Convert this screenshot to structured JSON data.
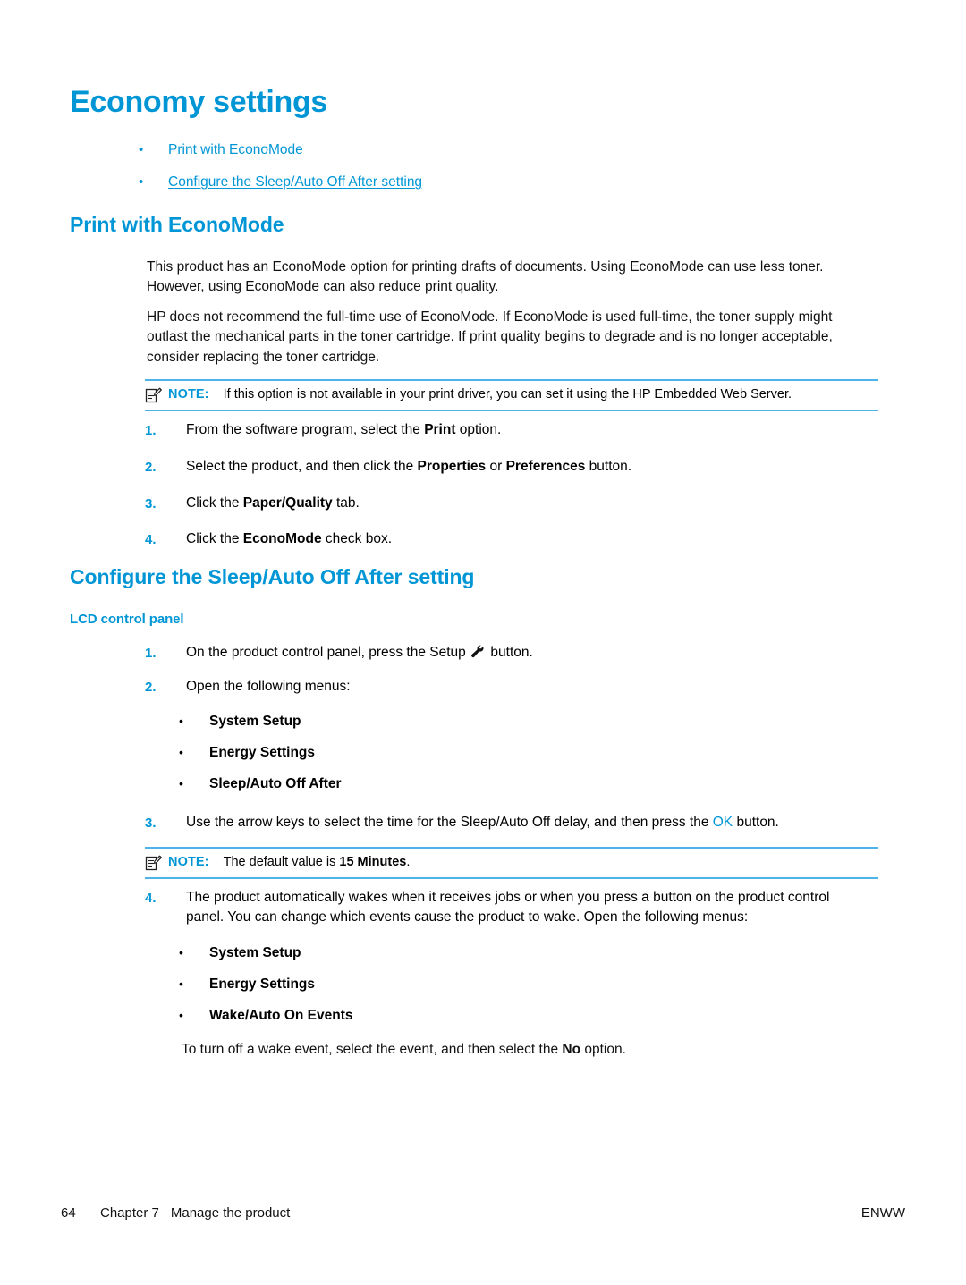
{
  "page": {
    "title": "Economy settings",
    "accent_color": "#0096D6",
    "rule_color": "#4EB3E8"
  },
  "toc": {
    "items": [
      {
        "bullet": "•",
        "label": "Print with EconoMode"
      },
      {
        "bullet": "•",
        "label": "Configure the Sleep/Auto Off After setting"
      }
    ]
  },
  "section_econo": {
    "heading": "Print with EconoMode",
    "paragraph_1": "This product has an EconoMode option for printing drafts of documents. Using EconoMode can use less toner. However, using EconoMode can also reduce print quality.",
    "paragraph_2": "HP does not recommend the full-time use of EconoMode. If EconoMode is used full-time, the toner supply might outlast the mechanical parts in the toner cartridge. If print quality begins to degrade and is no longer acceptable, consider replacing the toner cartridge.",
    "note": {
      "icon": "note-pencil-icon",
      "label": "NOTE:",
      "text": "If this option is not available in your print driver, you can set it using the HP Embedded Web Server."
    },
    "steps": [
      {
        "num": "1.",
        "text_before": "From the software program, select the ",
        "bold": "Print",
        "text_after": " option."
      },
      {
        "num": "2.",
        "text_before": "Select the product, and then click the ",
        "bold": "Properties",
        "mid": " or ",
        "bold2": "Preferences",
        "text_after": " button."
      },
      {
        "num": "3.",
        "text_before": "Click the ",
        "bold": "Paper/Quality",
        "text_after": " tab."
      },
      {
        "num": "4.",
        "text_before": "Click the ",
        "bold": "EconoMode",
        "text_after": " check box."
      }
    ]
  },
  "section_sleep": {
    "heading": "Configure the Sleep/Auto Off After setting",
    "subheading": "LCD control panel",
    "step1": {
      "num": "1.",
      "text_before": "On the product control panel, press the Setup ",
      "icon": "wrench-icon",
      "text_after": " button."
    },
    "step2": {
      "num": "2.",
      "text": "Open the following menus:",
      "menus": [
        {
          "bullet": "•",
          "label": "System Setup"
        },
        {
          "bullet": "•",
          "label": "Energy Settings"
        },
        {
          "bullet": "•",
          "label": "Sleep/Auto Off After"
        }
      ]
    },
    "step3": {
      "num": "3.",
      "text_before": "Use the arrow keys to select the time for the Sleep/Auto Off delay, and then press the ",
      "key": "OK",
      "text_after": " button."
    },
    "note": {
      "icon": "note-pencil-icon",
      "label": "NOTE:",
      "text_before": "The default value is ",
      "bold": "15 Minutes",
      "text_after": "."
    },
    "step4": {
      "num": "4.",
      "text": "The product automatically wakes when it receives jobs or when you press a button on the product control panel. You can change which events cause the product to wake. Open the following menus:",
      "menus": [
        {
          "bullet": "•",
          "label": "System Setup"
        },
        {
          "bullet": "•",
          "label": "Energy Settings"
        },
        {
          "bullet": "•",
          "label": "Wake/Auto On Events"
        }
      ]
    },
    "closing": {
      "text_before": "To turn off a wake event, select the event, and then select the ",
      "bold": "No",
      "text_after": " option."
    }
  },
  "footer": {
    "page_number": "64",
    "chapter": "Chapter 7",
    "chapter_title": "Manage the product",
    "locale": "ENWW"
  }
}
